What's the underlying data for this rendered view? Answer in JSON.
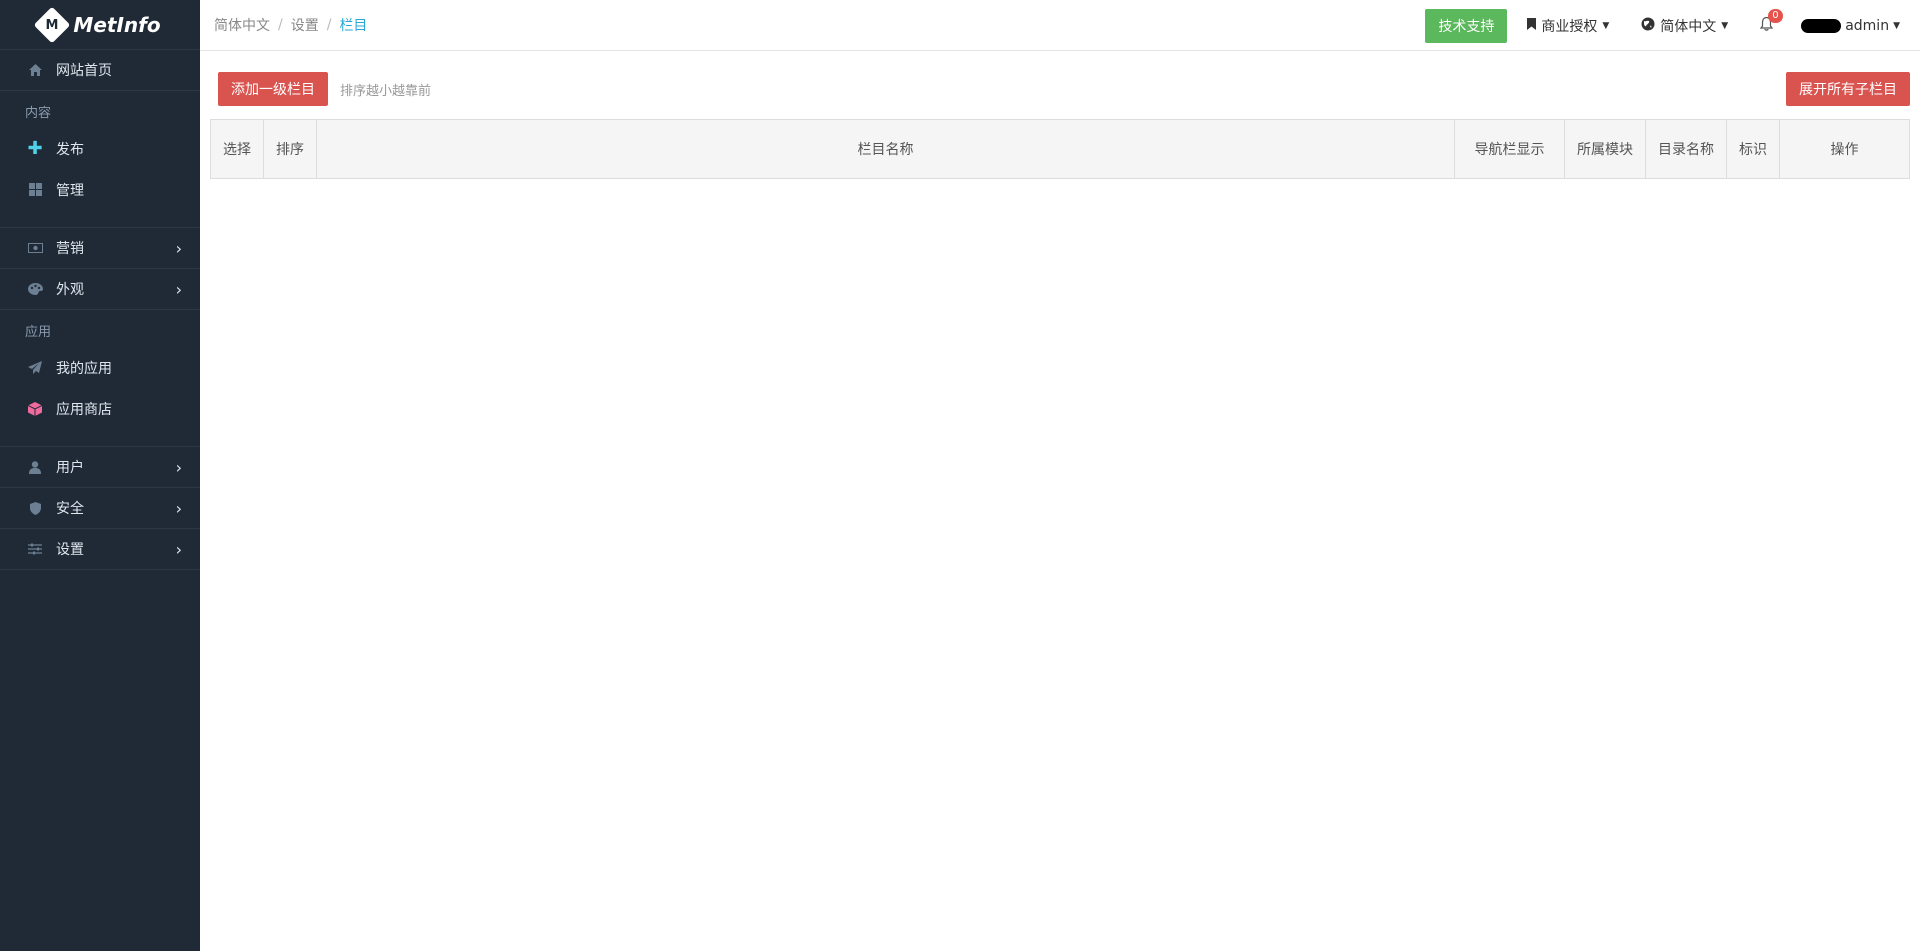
{
  "app": {
    "logo_text": "MetInfo",
    "logo_mark": "M"
  },
  "sidebar": {
    "items": [
      {
        "label": "网站首页",
        "icon": "home-icon"
      },
      {
        "section": "内容"
      },
      {
        "label": "发布",
        "icon": "plus-icon"
      },
      {
        "label": "管理",
        "icon": "grid-icon"
      },
      {
        "label": "营销",
        "icon": "money-icon"
      },
      {
        "label": "外观",
        "icon": "palette-icon"
      },
      {
        "section": "应用"
      },
      {
        "label": "我的应用",
        "icon": "paper-plane-icon"
      },
      {
        "label": "应用商店",
        "icon": "cube-icon"
      },
      {
        "label": "用户",
        "icon": "user-icon"
      },
      {
        "label": "安全",
        "icon": "shield-icon"
      },
      {
        "label": "设置",
        "icon": "sliders-icon"
      }
    ]
  },
  "header": {
    "breadcrumb": [
      "简体中文",
      "设置",
      "栏目"
    ],
    "support_button": "技术支持",
    "license_label": "商业授权",
    "language_label": "简体中文",
    "notification_count": "0",
    "username": "admin"
  },
  "main": {
    "add_button": "添加一级栏目",
    "hint": "排序越小越靠前",
    "expand_button": "展开所有子栏目",
    "table_headers": [
      "选择",
      "排序",
      "栏目名称",
      "导航栏显示",
      "所属模块",
      "目录名称",
      "标识",
      "操作"
    ]
  },
  "colors": {
    "sidebar_bg": "#1f2a36",
    "success": "#5cb85c",
    "danger": "#d9534f",
    "link_active": "#2aa7d6"
  }
}
